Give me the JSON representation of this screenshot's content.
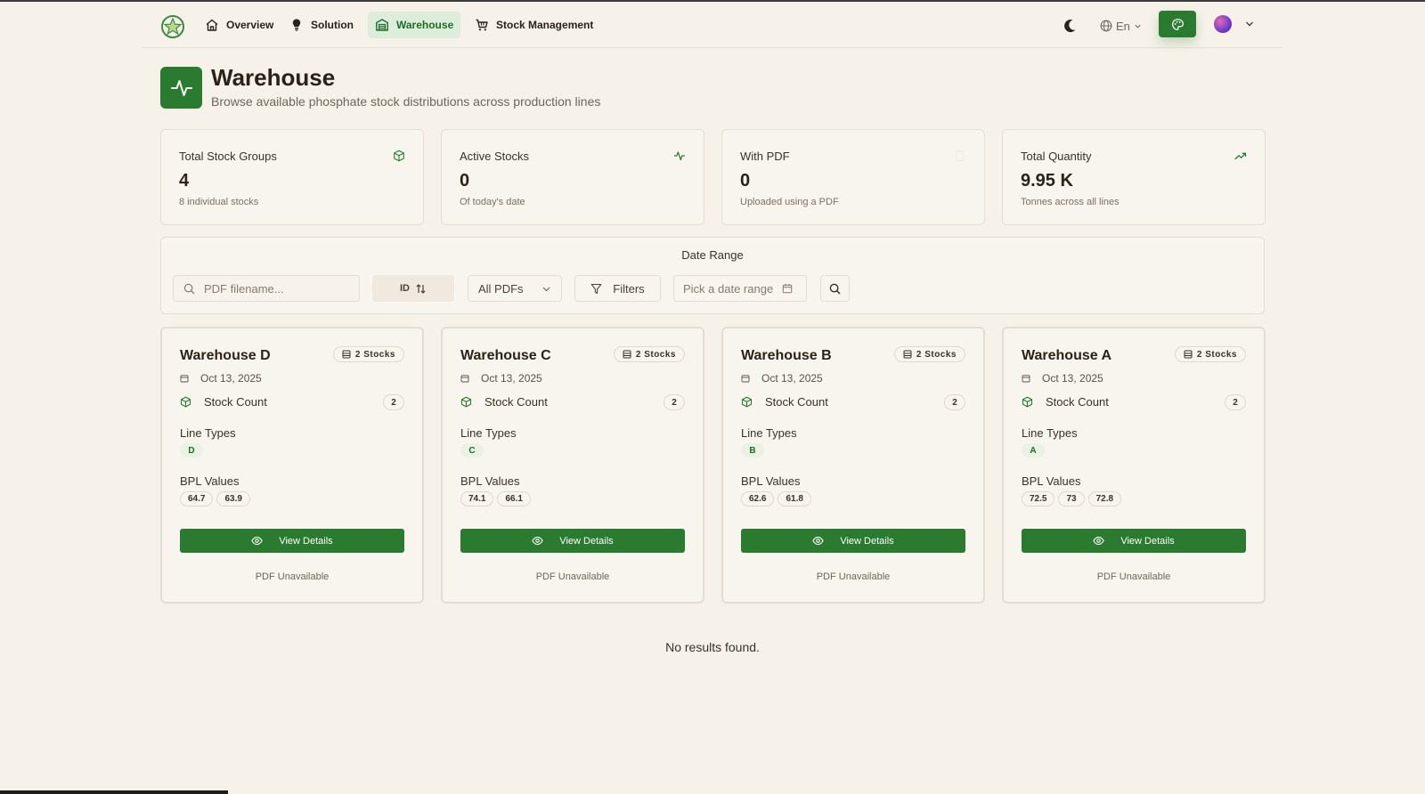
{
  "nav": {
    "items": [
      {
        "label": "Overview",
        "icon": "home-icon"
      },
      {
        "label": "Solution",
        "icon": "lightbulb-icon"
      },
      {
        "label": "Warehouse",
        "icon": "warehouse-icon",
        "active": true
      },
      {
        "label": "Stock Management",
        "icon": "cart-icon"
      }
    ],
    "language": "En"
  },
  "header": {
    "title": "Warehouse",
    "subtitle": "Browse available phosphate stock distributions across production lines"
  },
  "stats": [
    {
      "label": "Total Stock Groups",
      "value": "4",
      "note": "8 individual stocks",
      "icon": "package-icon"
    },
    {
      "label": "Active Stocks",
      "value": "0",
      "note": "Of today's date",
      "icon": "activity-icon"
    },
    {
      "label": "With PDF",
      "value": "0",
      "note": "Uploaded using a PDF",
      "icon": "file-icon"
    },
    {
      "label": "Total Quantity",
      "value": "9.95 K",
      "note": "Tonnes across all lines",
      "icon": "trending-up-icon"
    }
  ],
  "filters": {
    "date_range_label": "Date Range",
    "search_placeholder": "PDF filename...",
    "sort_label": "ID",
    "pdf_select": "All PDFs",
    "filters_label": "Filters",
    "date_placeholder": "Pick a date range"
  },
  "warehouses": [
    {
      "name": "Warehouse D",
      "badge": "2 Stocks",
      "date": "Oct 13, 2025",
      "stock_count_label": "Stock Count",
      "stock_count": "2",
      "line_types_label": "Line Types",
      "line_type": "D",
      "bpl_label": "BPL Values",
      "bpl": [
        "64.7",
        "63.9"
      ],
      "view_label": "View Details",
      "pdf_status": "PDF Unavailable"
    },
    {
      "name": "Warehouse C",
      "badge": "2 Stocks",
      "date": "Oct 13, 2025",
      "stock_count_label": "Stock Count",
      "stock_count": "2",
      "line_types_label": "Line Types",
      "line_type": "C",
      "bpl_label": "BPL Values",
      "bpl": [
        "74.1",
        "66.1"
      ],
      "view_label": "View Details",
      "pdf_status": "PDF Unavailable"
    },
    {
      "name": "Warehouse B",
      "badge": "2 Stocks",
      "date": "Oct 13, 2025",
      "stock_count_label": "Stock Count",
      "stock_count": "2",
      "line_types_label": "Line Types",
      "line_type": "B",
      "bpl_label": "BPL Values",
      "bpl": [
        "62.6",
        "61.8"
      ],
      "view_label": "View Details",
      "pdf_status": "PDF Unavailable"
    },
    {
      "name": "Warehouse A",
      "badge": "2 Stocks",
      "date": "Oct 13, 2025",
      "stock_count_label": "Stock Count",
      "stock_count": "2",
      "line_types_label": "Line Types",
      "line_type": "A",
      "bpl_label": "BPL Values",
      "bpl": [
        "72.5",
        "73",
        "72.8"
      ],
      "view_label": "View Details",
      "pdf_status": "PDF Unavailable"
    }
  ],
  "no_results": "No results found.",
  "colors": {
    "primary": "#2a7a2f",
    "background": "#f6f2ea",
    "card": "#f8f5ef",
    "border": "#e4ddd1",
    "active_nav_bg": "#dceeda"
  }
}
